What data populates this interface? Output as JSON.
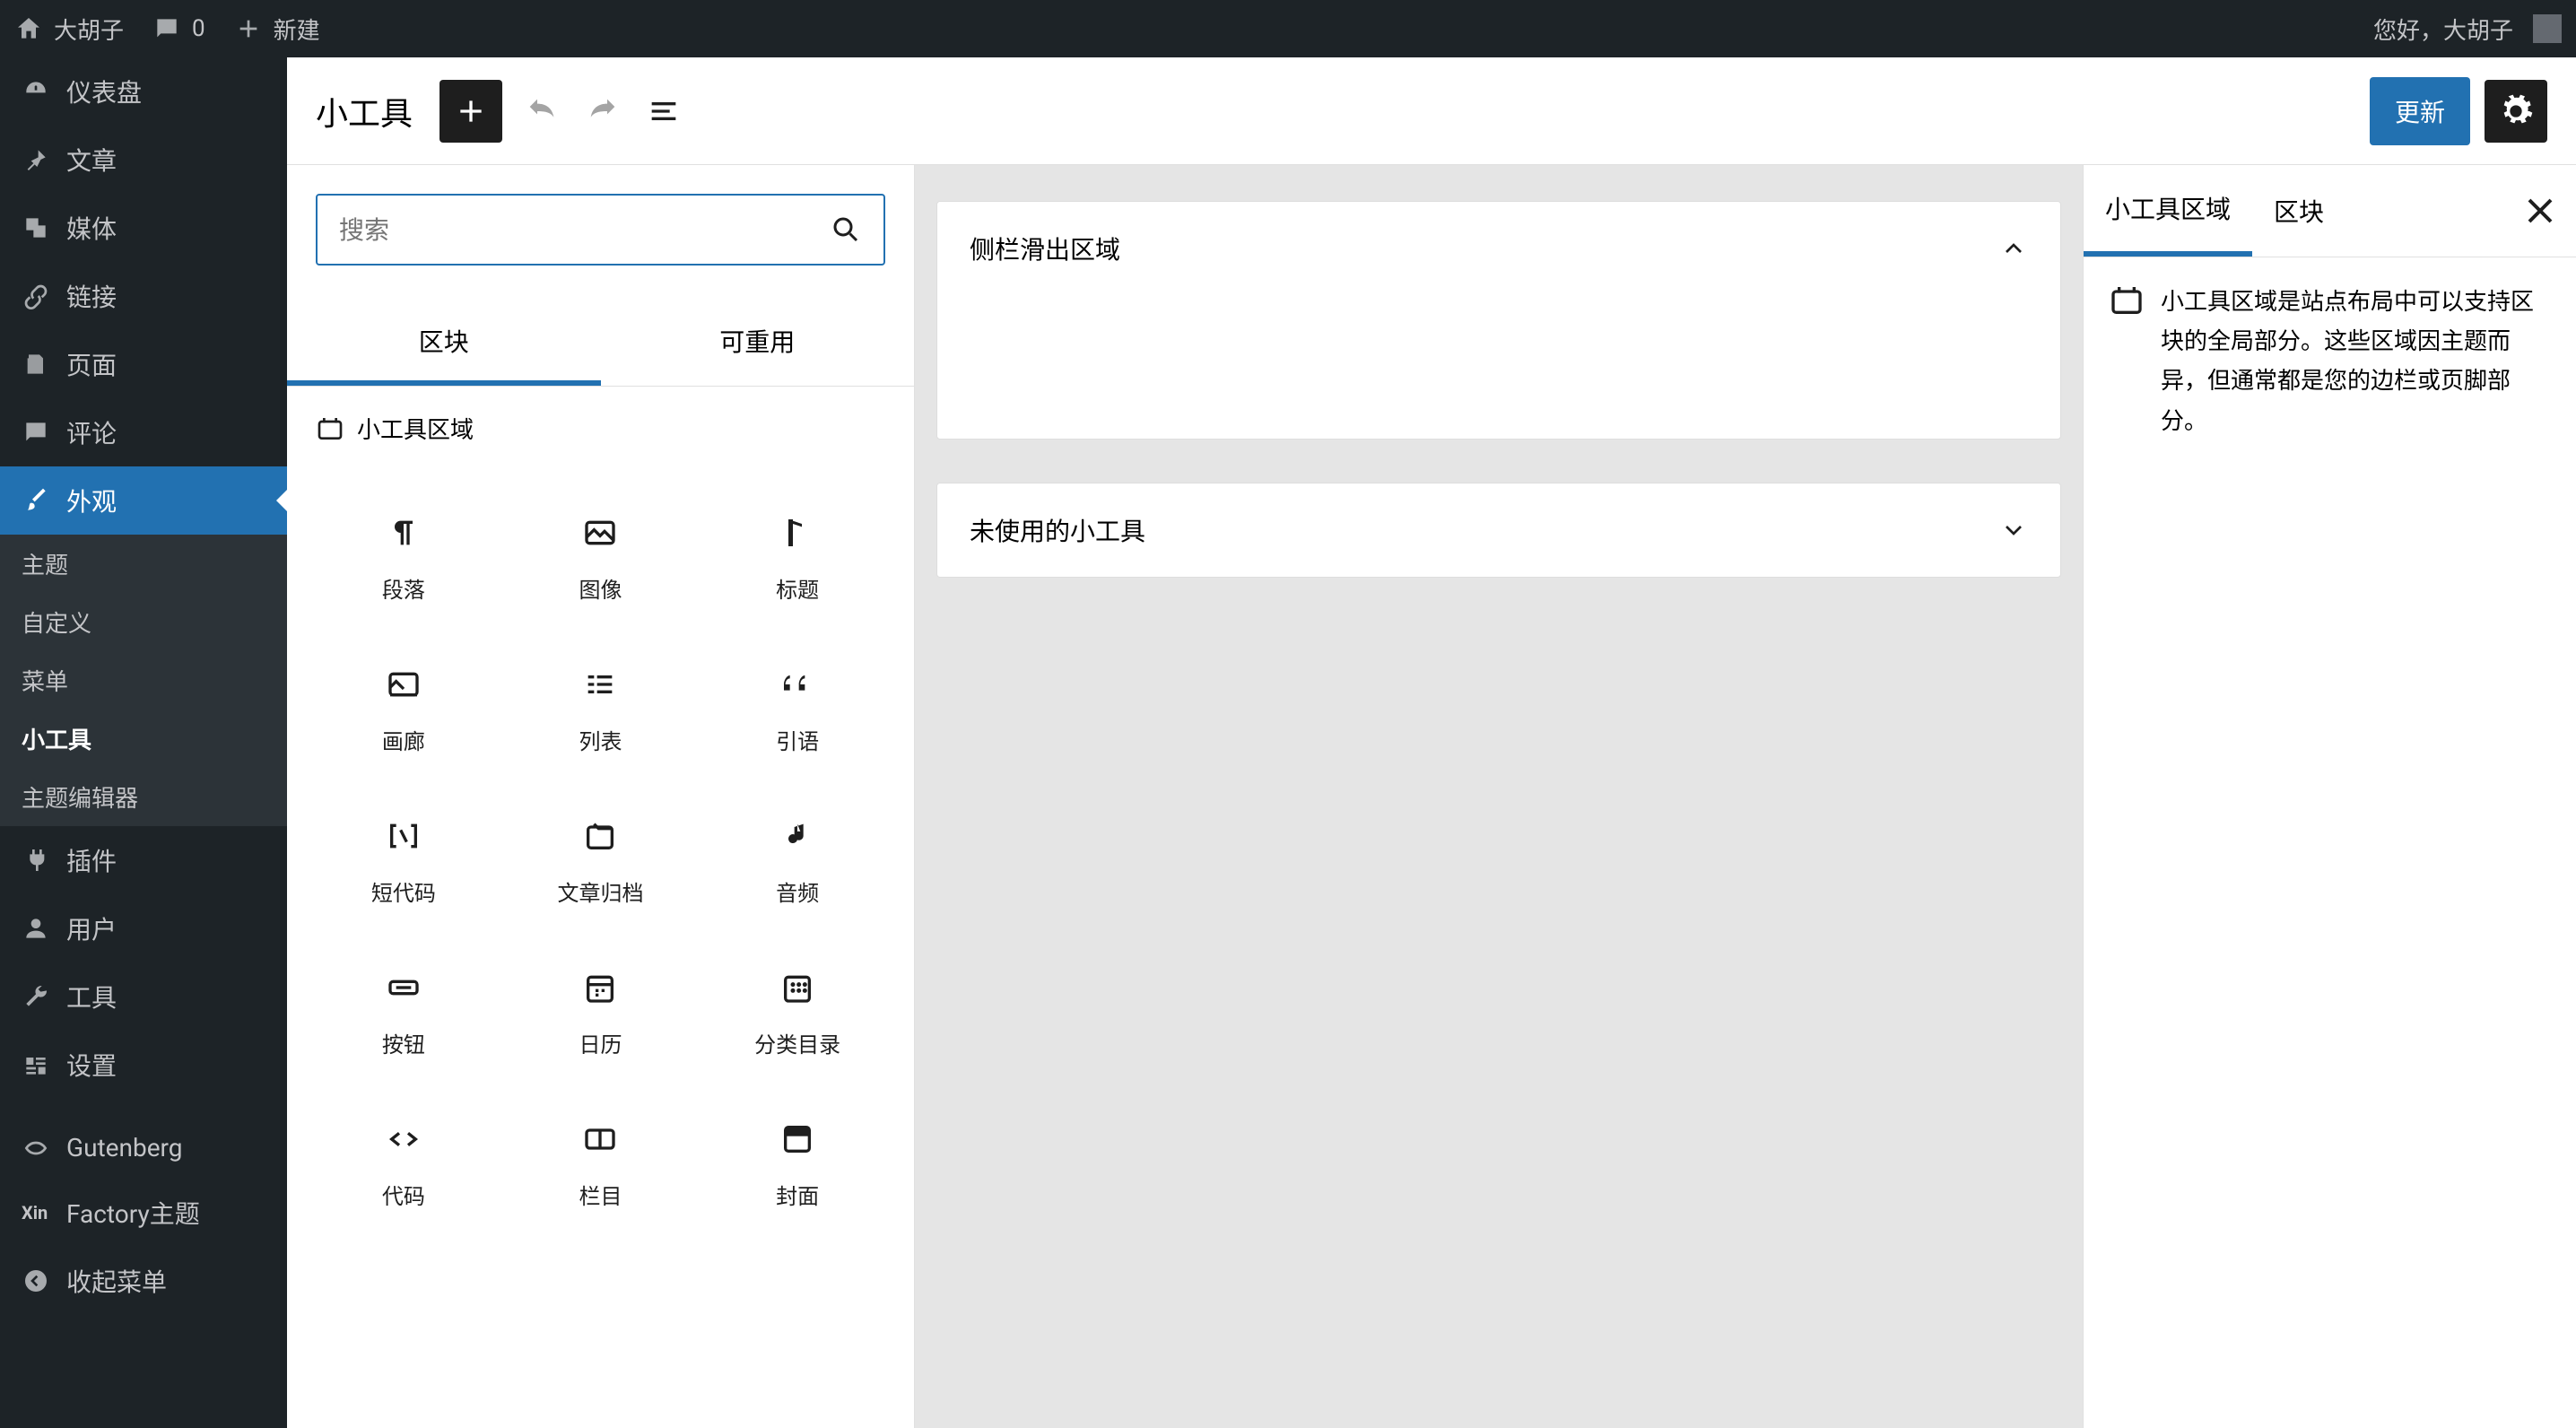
{
  "topbar": {
    "site_name": "大胡子",
    "comments_count": "0",
    "new_label": "新建",
    "greeting": "您好，大胡子"
  },
  "sidebar": {
    "items": [
      {
        "id": "dashboard",
        "label": "仪表盘"
      },
      {
        "id": "posts",
        "label": "文章"
      },
      {
        "id": "media",
        "label": "媒体"
      },
      {
        "id": "links",
        "label": "链接"
      },
      {
        "id": "pages",
        "label": "页面"
      },
      {
        "id": "comments",
        "label": "评论"
      },
      {
        "id": "appearance",
        "label": "外观"
      },
      {
        "id": "plugins",
        "label": "插件"
      },
      {
        "id": "users",
        "label": "用户"
      },
      {
        "id": "tools",
        "label": "工具"
      },
      {
        "id": "settings",
        "label": "设置"
      },
      {
        "id": "gutenberg",
        "label": "Gutenberg"
      },
      {
        "id": "factory",
        "label": "Factory主题"
      },
      {
        "id": "collapse",
        "label": "收起菜单"
      }
    ],
    "appearance_sub": [
      {
        "id": "themes",
        "label": "主题"
      },
      {
        "id": "customize",
        "label": "自定义"
      },
      {
        "id": "menus",
        "label": "菜单"
      },
      {
        "id": "widgets",
        "label": "小工具"
      },
      {
        "id": "theme-editor",
        "label": "主题编辑器"
      }
    ]
  },
  "editor": {
    "title": "小工具",
    "update_label": "更新"
  },
  "inserter": {
    "search_placeholder": "搜索",
    "tabs": {
      "blocks": "区块",
      "reusable": "可重用"
    },
    "section_heading": "小工具区域",
    "blocks": [
      {
        "id": "paragraph",
        "label": "段落"
      },
      {
        "id": "image",
        "label": "图像"
      },
      {
        "id": "heading",
        "label": "标题"
      },
      {
        "id": "gallery",
        "label": "画廊"
      },
      {
        "id": "list",
        "label": "列表"
      },
      {
        "id": "quote",
        "label": "引语"
      },
      {
        "id": "shortcode",
        "label": "短代码"
      },
      {
        "id": "archives",
        "label": "文章归档"
      },
      {
        "id": "audio",
        "label": "音频"
      },
      {
        "id": "button",
        "label": "按钮"
      },
      {
        "id": "calendar",
        "label": "日历"
      },
      {
        "id": "categories",
        "label": "分类目录"
      },
      {
        "id": "code",
        "label": "代码"
      },
      {
        "id": "columns",
        "label": "栏目"
      },
      {
        "id": "cover",
        "label": "封面"
      }
    ]
  },
  "canvas": {
    "areas": [
      {
        "id": "sidebar-slide",
        "title": "侧栏滑出区域",
        "expanded": true
      },
      {
        "id": "unused",
        "title": "未使用的小工具",
        "expanded": false
      }
    ]
  },
  "rightpanel": {
    "tabs": {
      "widget_area": "小工具区域",
      "block": "区块"
    },
    "description": "小工具区域是站点布局中可以支持区块的全局部分。这些区域因主题而异，但通常都是您的边栏或页脚部分。"
  }
}
